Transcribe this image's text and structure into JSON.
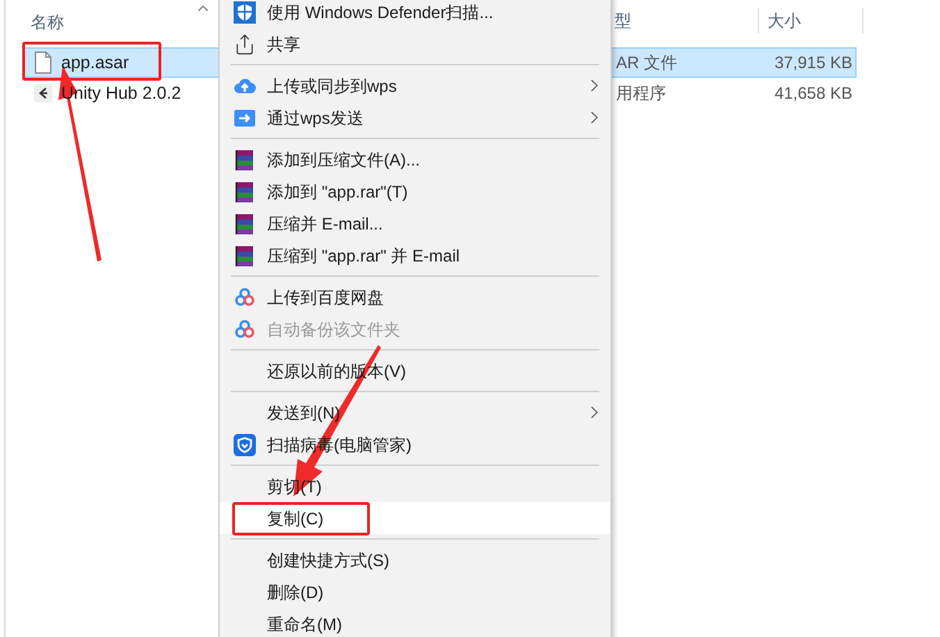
{
  "columns": [
    {
      "label": "名称"
    },
    {
      "label": "型"
    },
    {
      "label": "大小"
    }
  ],
  "files": [
    {
      "name": "app.asar",
      "kind": "file",
      "type": "AR 文件",
      "size": "37,915 KB",
      "selected": true,
      "marked": true
    },
    {
      "name": "Unity Hub 2.0.2",
      "kind": "shortcut",
      "type": "用程序",
      "size": "41,658 KB",
      "selected": false,
      "marked": false
    }
  ],
  "menu": [
    {
      "kind": "defender",
      "label": "使用 Windows Defender扫描...",
      "submenu": false,
      "disabled": false,
      "selected": false,
      "marked": false
    },
    {
      "kind": "share",
      "label": "共享",
      "submenu": false,
      "disabled": false,
      "selected": false,
      "marked": false
    },
    {
      "kind": "separator"
    },
    {
      "kind": "cloud",
      "label": "上传或同步到wps",
      "submenu": true,
      "disabled": false,
      "selected": false,
      "marked": false
    },
    {
      "kind": "send",
      "label": "通过wps发送",
      "submenu": true,
      "disabled": false,
      "selected": false,
      "marked": false
    },
    {
      "kind": "separator"
    },
    {
      "kind": "archive",
      "label": "添加到压缩文件(A)...",
      "submenu": false,
      "disabled": false,
      "selected": false,
      "marked": false
    },
    {
      "kind": "archive",
      "label": "添加到 \"app.rar\"(T)",
      "submenu": false,
      "disabled": false,
      "selected": false,
      "marked": false
    },
    {
      "kind": "archive",
      "label": "压缩并 E-mail...",
      "submenu": false,
      "disabled": false,
      "selected": false,
      "marked": false
    },
    {
      "kind": "archive",
      "label": "压缩到 \"app.rar\" 并 E-mail",
      "submenu": false,
      "disabled": false,
      "selected": false,
      "marked": false
    },
    {
      "kind": "separator"
    },
    {
      "kind": "netdisk",
      "label": "上传到百度网盘",
      "submenu": false,
      "disabled": false,
      "selected": false,
      "marked": false
    },
    {
      "kind": "netdisk",
      "label": "自动备份该文件夹",
      "submenu": false,
      "disabled": true,
      "selected": false,
      "marked": false
    },
    {
      "kind": "separator"
    },
    {
      "kind": "plain",
      "label": "还原以前的版本(V)",
      "submenu": false,
      "disabled": false,
      "selected": false,
      "marked": false
    },
    {
      "kind": "separator"
    },
    {
      "kind": "plain",
      "label": "发送到(N)",
      "submenu": true,
      "disabled": false,
      "selected": false,
      "marked": false
    },
    {
      "kind": "guard",
      "label": "扫描病毒(电脑管家)",
      "submenu": false,
      "disabled": false,
      "selected": false,
      "marked": false
    },
    {
      "kind": "separator"
    },
    {
      "kind": "plain",
      "label": "剪切(T)",
      "submenu": false,
      "disabled": false,
      "selected": false,
      "marked": false
    },
    {
      "kind": "plain",
      "label": "复制(C)",
      "submenu": false,
      "disabled": false,
      "selected": true,
      "marked": true
    },
    {
      "kind": "separator"
    },
    {
      "kind": "plain",
      "label": "创建快捷方式(S)",
      "submenu": false,
      "disabled": false,
      "selected": false,
      "marked": false
    },
    {
      "kind": "plain",
      "label": "删除(D)",
      "submenu": false,
      "disabled": false,
      "selected": false,
      "marked": false
    },
    {
      "kind": "plain",
      "label": "重命名(M)",
      "submenu": false,
      "disabled": false,
      "selected": false,
      "marked": false
    }
  ]
}
